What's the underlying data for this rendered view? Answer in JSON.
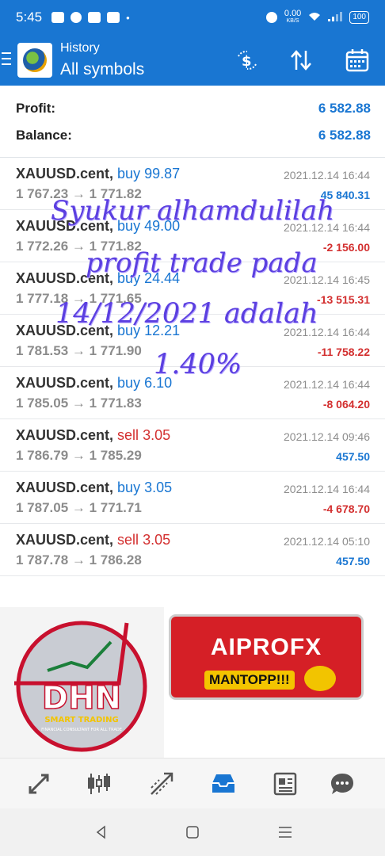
{
  "status_bar": {
    "time": "5:45",
    "net_speed_value": "0.00",
    "net_speed_unit": "KB/S",
    "battery": "100"
  },
  "app_bar": {
    "title_top": "History",
    "title_main": "All symbols",
    "icons": [
      "menu-icon",
      "app-logo",
      "currency-icon",
      "sort-icon",
      "calendar-icon"
    ]
  },
  "summary": {
    "profit_label": "Profit:",
    "profit_value": "6 582.88",
    "balance_label": "Balance:",
    "balance_value": "6 582.88"
  },
  "trades": [
    {
      "symbol": "XAUUSD.cent,",
      "side": "buy",
      "volume": "99.87",
      "prices": "1 767.23 → 1 771.82",
      "date": "2021.12.14 16:44",
      "profit": "45 840.31",
      "profit_type": "pos"
    },
    {
      "symbol": "XAUUSD.cent,",
      "side": "buy",
      "volume": "49.00",
      "prices": "1 772.26 → 1 771.82",
      "date": "2021.12.14 16:44",
      "profit": "-2 156.00",
      "profit_type": "neg"
    },
    {
      "symbol": "XAUUSD.cent,",
      "side": "buy",
      "volume": "24.44",
      "prices": "1 777.18 → 1 771.65",
      "date": "2021.12.14 16:45",
      "profit": "-13 515.31",
      "profit_type": "neg"
    },
    {
      "symbol": "XAUUSD.cent,",
      "side": "buy",
      "volume": "12.21",
      "prices": "1 781.53 → 1 771.90",
      "date": "2021.12.14 16:44",
      "profit": "-11 758.22",
      "profit_type": "neg"
    },
    {
      "symbol": "XAUUSD.cent,",
      "side": "buy",
      "volume": "6.10",
      "prices": "1 785.05 → 1 771.83",
      "date": "2021.12.14 16:44",
      "profit": "-8 064.20",
      "profit_type": "neg"
    },
    {
      "symbol": "XAUUSD.cent,",
      "side": "sell",
      "volume": "3.05",
      "prices": "1 786.79 → 1 785.29",
      "date": "2021.12.14 09:46",
      "profit": "457.50",
      "profit_type": "pos"
    },
    {
      "symbol": "XAUUSD.cent,",
      "side": "buy",
      "volume": "3.05",
      "prices": "1 787.05 → 1 771.71",
      "date": "2021.12.14 16:44",
      "profit": "-4 678.70",
      "profit_type": "neg"
    },
    {
      "symbol": "XAUUSD.cent,",
      "side": "sell",
      "volume": "3.05",
      "prices": "1 787.78 → 1 786.28",
      "date": "2021.12.14 05:10",
      "profit": "457.50",
      "profit_type": "pos"
    }
  ],
  "overlay": {
    "line1": "Syukur alhamdulilah",
    "line2": "profit trade pada",
    "line3": "14/12/2021 adalah",
    "line4": "1.40%"
  },
  "logos": {
    "left_brand": "DHN",
    "left_tagline": "SMART TRADING",
    "left_subtag": "FINANCIAL CONSULTANT FOR ALL TRADE",
    "right_brand": "AIPROFX",
    "right_slogan": "MANTOPP!!!"
  },
  "bottom_nav": [
    "quotes-icon",
    "chart-icon",
    "trade-icon",
    "history-icon",
    "news-icon",
    "chat-icon"
  ],
  "colors": {
    "primary": "#1976d2",
    "negative": "#d32f2f",
    "overlay_text": "#5b3fe0"
  }
}
